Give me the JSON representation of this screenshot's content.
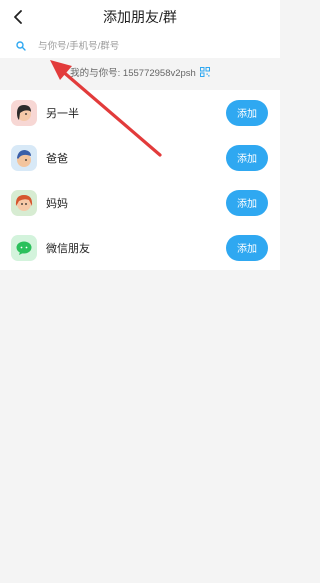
{
  "header": {
    "title": "添加朋友/群"
  },
  "search": {
    "placeholder": "与你号/手机号/群号"
  },
  "my_id": {
    "text": "我的与你号: 155772958v2psh"
  },
  "contacts": [
    {
      "label": "另一半",
      "action": "添加",
      "icon": "woman-avatar-icon"
    },
    {
      "label": "爸爸",
      "action": "添加",
      "icon": "dad-avatar-icon"
    },
    {
      "label": "妈妈",
      "action": "添加",
      "icon": "mom-avatar-icon"
    },
    {
      "label": "微信朋友",
      "action": "添加",
      "icon": "wechat-icon"
    }
  ],
  "colors": {
    "accent": "#2fa8f1",
    "annotation_arrow": "#e23b3b"
  }
}
